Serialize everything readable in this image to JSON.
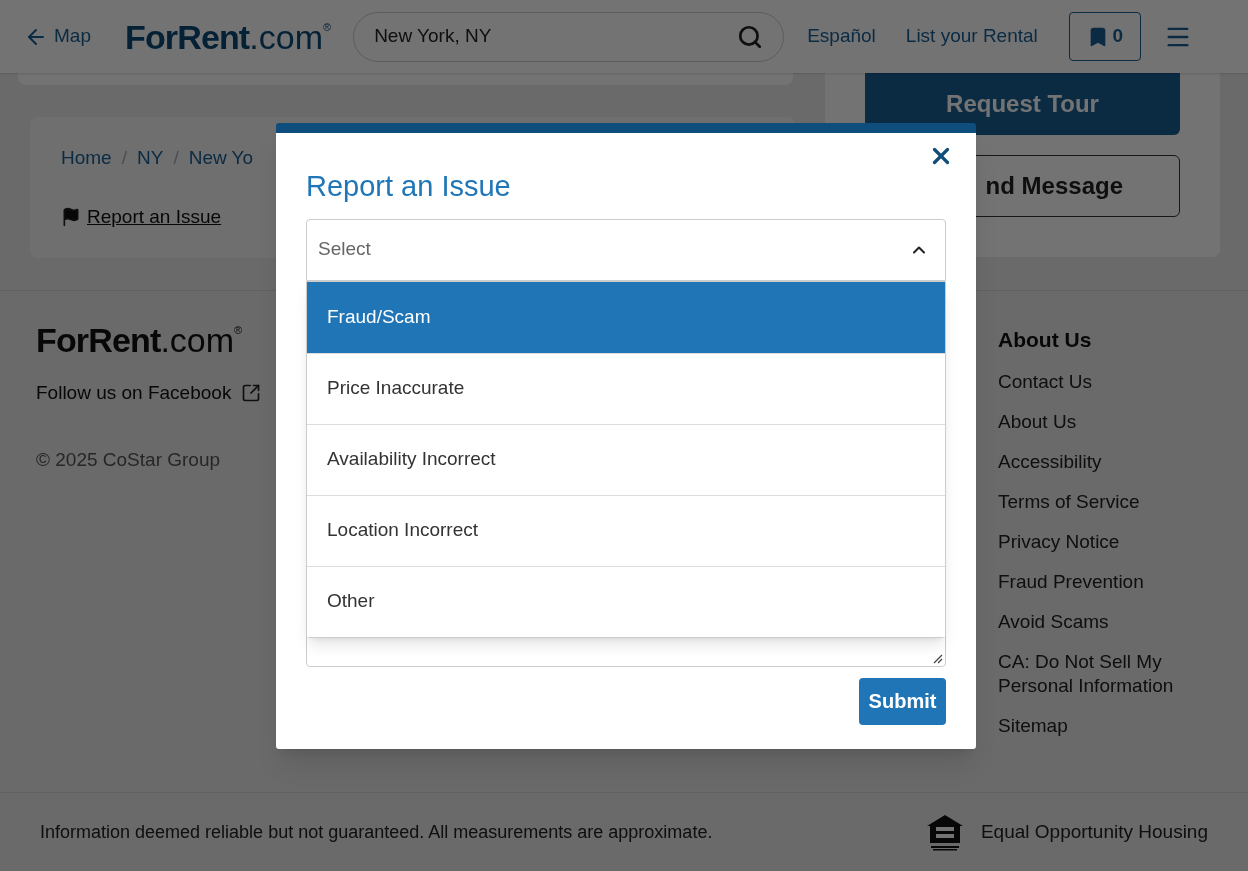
{
  "header": {
    "back_link": "Map",
    "logo": {
      "name": "ForRent",
      "suffix": ".com",
      "mark": "®"
    },
    "search": {
      "value": "New York, NY"
    },
    "links": [
      "Español",
      "List your Rental"
    ],
    "saved_count": "0"
  },
  "breadcrumbs": [
    {
      "label": "Home",
      "separator": "/"
    },
    {
      "label": "NY",
      "separator": "/"
    },
    {
      "label": "New Yo"
    }
  ],
  "report_link": "Report an Issue",
  "contact_buttons": [
    "Request Tour",
    "nd Message"
  ],
  "footer": {
    "logo": {
      "name": "ForRent",
      "suffix": ".com",
      "mark": "®"
    },
    "facebook": "Follow us on Facebook",
    "copyright": "© 2025 CoStar Group",
    "about": {
      "heading": "About Us",
      "links": [
        "Contact Us",
        "About Us",
        "Accessibility",
        "Terms of Service",
        "Privacy Notice",
        "Fraud Prevention",
        "Avoid Scams",
        "CA: Do Not Sell My Personal Information",
        "Sitemap"
      ]
    }
  },
  "bottom_bar": {
    "disclaimer": "Information deemed reliable but not guaranteed. All measurements are approximate.",
    "housing": "Equal Opportunity Housing"
  },
  "modal": {
    "title": "Report an Issue",
    "select": {
      "placeholder": "Select",
      "expanded": true
    },
    "options": [
      {
        "label": "Fraud/Scam",
        "selected": true
      },
      {
        "label": "Price Inaccurate",
        "selected": false
      },
      {
        "label": "Availability Incorrect",
        "selected": false
      },
      {
        "label": "Location Incorrect",
        "selected": false
      },
      {
        "label": "Other",
        "selected": false
      }
    ],
    "submit": "Submit"
  }
}
